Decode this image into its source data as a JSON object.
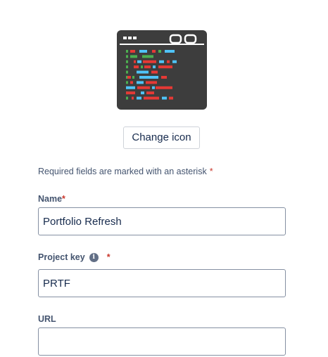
{
  "project_icon": {
    "icon": "code-window-icon",
    "frame_color": "#3d3d3d",
    "code_colors": [
      "#4caf50",
      "#e53935",
      "#4fc3f7"
    ]
  },
  "change_icon_label": "Change icon",
  "required_note": {
    "text": "Required fields are marked with an asterisk",
    "asterisk": "*"
  },
  "fields": {
    "name": {
      "label": "Name",
      "asterisk": "*",
      "value": "Portfolio Refresh"
    },
    "project_key": {
      "label": "Project key",
      "info_icon": "info-icon",
      "info_glyph": "i",
      "asterisk": "*",
      "value": "PRTF"
    },
    "url": {
      "label": "URL",
      "value": ""
    }
  },
  "colors": {
    "required_asterisk": "#c9372c",
    "input_border": "#8590a2"
  }
}
